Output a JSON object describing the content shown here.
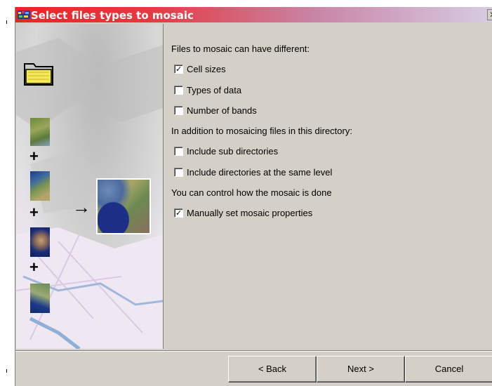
{
  "window": {
    "title": "Select files types to mosaic",
    "close_glyph": "✕"
  },
  "content": {
    "heading_differences": "Files to mosaic can have different:",
    "options_differences": [
      {
        "label": "Cell sizes",
        "checked": true
      },
      {
        "label": "Types of data",
        "checked": false
      },
      {
        "label": "Number of bands",
        "checked": false
      }
    ],
    "heading_directories": "In addition to mosaicing files in this directory:",
    "options_directories": [
      {
        "label": "Include sub directories",
        "checked": false
      },
      {
        "label": "Include directories at the same level",
        "checked": false
      }
    ],
    "heading_control": "You can control how the mosaic is done",
    "options_control": [
      {
        "label": "Manually set mosaic properties",
        "checked": true
      }
    ]
  },
  "buttons": {
    "back": "< Back",
    "next": "Next >",
    "cancel": "Cancel"
  },
  "side_panel": {
    "plus_glyph": "+",
    "arrow_glyph": "→",
    "icons": [
      "folder-icon",
      "tile-thumbnail-icon",
      "mosaic-result-icon"
    ]
  },
  "colors": {
    "titlebar_start": "#ed2424",
    "titlebar_end": "#d7cfe6",
    "dialog_bg": "#d4d0c8",
    "check_mark": "#000000"
  }
}
